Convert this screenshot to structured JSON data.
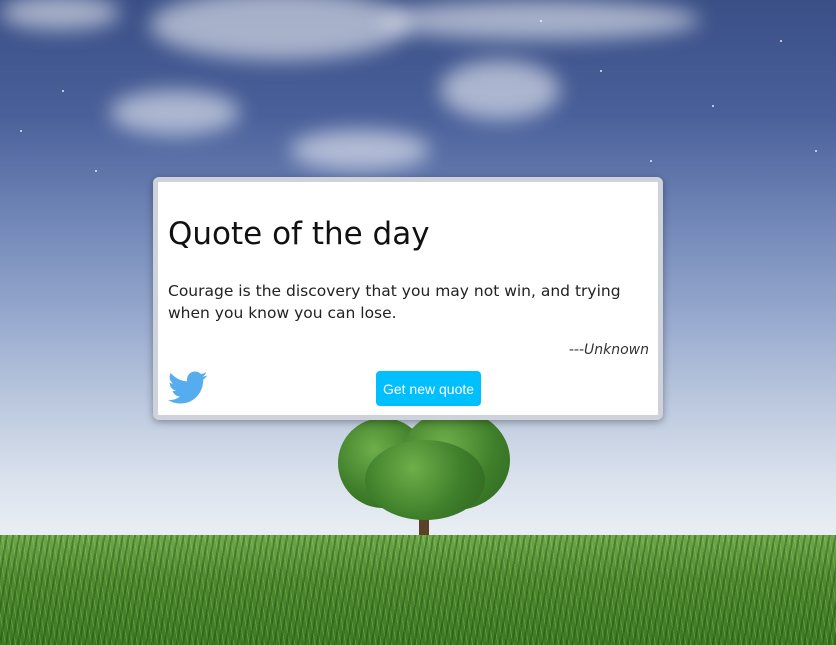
{
  "card": {
    "title": "Quote of the day",
    "quote": "Courage is the discovery that you may not win, and trying when you know you can lose.",
    "author": "---Unknown",
    "new_quote_label": "Get new quote",
    "tweet_icon": "twitter-bird-icon"
  },
  "colors": {
    "button": "#00bfff",
    "twitter": "#55acee",
    "card_background": "#ffffff"
  }
}
